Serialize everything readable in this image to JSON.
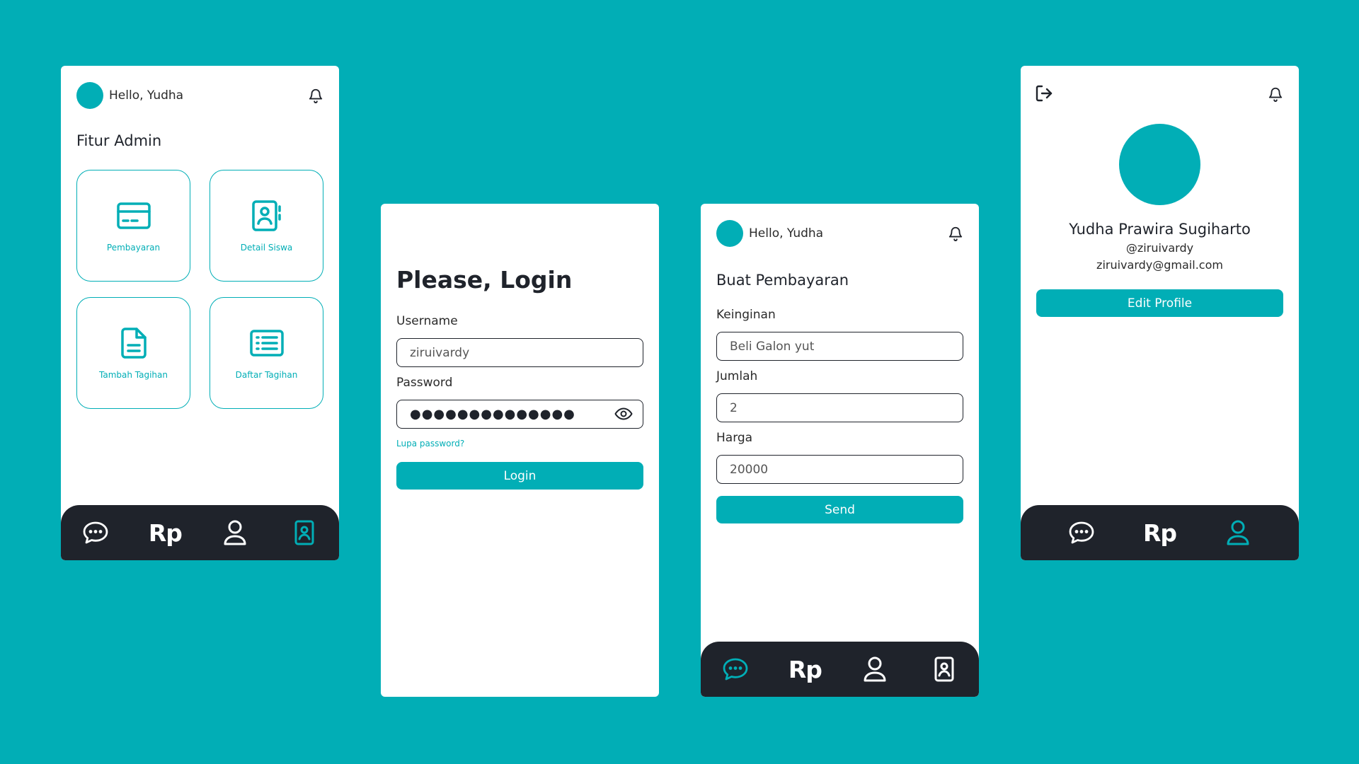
{
  "colors": {
    "accent": "#01AEB6",
    "dark": "#1F232B",
    "surface": "#FFFFFF",
    "background": "#01AEB6"
  },
  "admin_screen": {
    "greeting": "Hello, Yudha",
    "section_title": "Fitur Admin",
    "features": [
      {
        "label": "Pembayaran",
        "icon": "credit-card-icon"
      },
      {
        "label": "Detail Siswa",
        "icon": "contact-book-icon"
      },
      {
        "label": "Tambah Tagihan",
        "icon": "document-icon"
      },
      {
        "label": "Daftar Tagihan",
        "icon": "list-icon"
      }
    ],
    "nav": {
      "items": [
        "chat-icon",
        "rupiah-icon",
        "user-icon",
        "id-card-icon"
      ],
      "active": "id-card-icon",
      "rupiah_text": "Rp"
    }
  },
  "login_screen": {
    "title": "Please, Login",
    "username_label": "Username",
    "username_value": "ziruivardy",
    "password_label": "Password",
    "password_value": "●●●●●●●●●●●●●●",
    "forgot_link": "Lupa password?",
    "login_button": "Login"
  },
  "payment_screen": {
    "greeting": "Hello, Yudha",
    "section_title": "Buat Pembayaran",
    "keinginan_label": "Keinginan",
    "keinginan_value": "Beli Galon yut",
    "jumlah_label": "Jumlah",
    "jumlah_value": "2",
    "harga_label": "Harga",
    "harga_value": "20000",
    "send_button": "Send",
    "nav": {
      "items": [
        "chat-icon",
        "rupiah-icon",
        "user-icon",
        "id-card-icon"
      ],
      "active": "chat-icon",
      "rupiah_text": "Rp"
    }
  },
  "profile_screen": {
    "name": "Yudha Prawira Sugiharto",
    "handle": "@ziruivardy",
    "email": "ziruivardy@gmail.com",
    "edit_button": "Edit Profile",
    "nav": {
      "items": [
        "chat-icon",
        "rupiah-icon",
        "user-icon"
      ],
      "active": "user-icon",
      "rupiah_text": "Rp"
    }
  }
}
